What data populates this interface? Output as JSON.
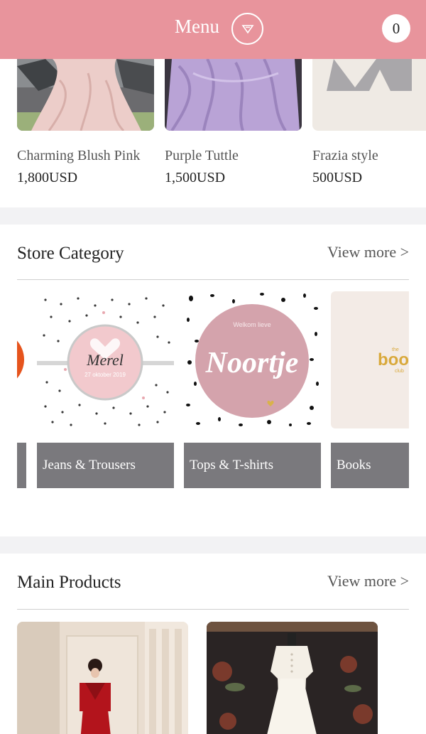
{
  "header": {
    "menu_label": "Menu",
    "cart_count": "0",
    "bg_color": "#e8949c"
  },
  "featured": [
    {
      "name": "Charming Blush Pink",
      "price": "1,800USD"
    },
    {
      "name": "Purple Tuttle",
      "price": "1,500USD"
    },
    {
      "name": "Frazia style",
      "price": "500USD"
    }
  ],
  "store_category": {
    "title": "Store Category",
    "view_more": "View more >",
    "items": [
      {
        "label": "Jeans & Trousers",
        "art_top": "Merel",
        "art_sub": "27 oktober 2019"
      },
      {
        "label": "Tops & T-shirts",
        "art_top": "Welkom lieve",
        "art_main": "Noortje"
      },
      {
        "label": "Books",
        "art_top": "the",
        "art_main": "boo",
        "art_sub": "club"
      }
    ]
  },
  "main_products": {
    "title": "Main Products",
    "view_more": "View more >"
  }
}
